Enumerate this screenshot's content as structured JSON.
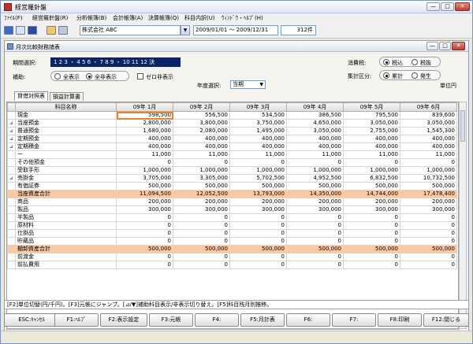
{
  "window": {
    "title": "経営羅針盤",
    "min": "—",
    "max": "□",
    "close": "✕"
  },
  "menu": [
    "ﾌｧｲﾙ(F)",
    "経営羅針盤(R)",
    "分析帳簿(B)",
    "会計帳簿(A)",
    "決算帳簿(Q)",
    "科目内訳(U)",
    "ｳｨﾝﾄﾞｳ・ﾍﾙﾌﾟ(H)"
  ],
  "toolbar": {
    "company": "株式会社 ABC",
    "period_range": "2009/01/01 〜 2009/12/31",
    "count": "312件"
  },
  "child": {
    "title": "月次比較財務諸表"
  },
  "controls": {
    "period_label": "期間選択:",
    "period_value": "1 2 3 ・ 4 5 6 ・ 7 8 9 ・ 10 11 12 決",
    "hojo_label": "補助:",
    "hojo_all": "全表示",
    "hojo_all_zan": "全非表示",
    "zero_label": "ゼロ非表示",
    "tax_label": "消費税:",
    "tax_incl": "税込",
    "tax_excl": "税抜",
    "agg_label": "集計区分:",
    "agg_cum": "累計",
    "agg_gen": "発生",
    "year_label": "年度選択:",
    "year_value": "当期",
    "unit": "単位円"
  },
  "tabs": [
    "貸借対照表",
    "損益計算書"
  ],
  "table": {
    "columns": [
      "科目名称",
      "09年 1月",
      "09年 2月",
      "09年 3月",
      "09年 4月",
      "09年 5月",
      "09年 6月"
    ],
    "rows": [
      {
        "exp": "",
        "name": "現金",
        "v": [
          "598,500",
          "556,500",
          "534,500",
          "386,500",
          "795,500",
          "839,600"
        ],
        "hl": false
      },
      {
        "exp": "⊿",
        "name": "当座預金",
        "v": [
          "2,800,000",
          "3,800,000",
          "3,750,000",
          "4,650,000",
          "3,050,000",
          "3,050,000"
        ],
        "hl": false
      },
      {
        "exp": "⊿",
        "name": "普通預金",
        "v": [
          "1,680,000",
          "2,080,000",
          "1,495,000",
          "3,050,000",
          "2,755,000",
          "1,545,300"
        ],
        "hl": false
      },
      {
        "exp": "⊿",
        "name": "定期預金",
        "v": [
          "400,000",
          "400,000",
          "400,000",
          "400,000",
          "400,000",
          "400,000"
        ],
        "hl": false
      },
      {
        "exp": "⊿",
        "name": "定期積金",
        "v": [
          "400,000",
          "400,000",
          "400,000",
          "400,000",
          "400,000",
          "400,000"
        ],
        "hl": false
      },
      {
        "exp": "",
        "name": "ー",
        "v": [
          "11,000",
          "11,000",
          "11,000",
          "11,000",
          "11,000",
          "11,000"
        ],
        "hl": false
      },
      {
        "exp": "",
        "name": "その他預金",
        "v": [
          "0",
          "0",
          "0",
          "0",
          "0",
          "0"
        ],
        "hl": false
      },
      {
        "exp": "",
        "name": "受取手形",
        "v": [
          "1,000,000",
          "1,000,000",
          "1,000,000",
          "1,000,000",
          "1,000,000",
          "1,000,000"
        ],
        "hl": false
      },
      {
        "exp": "⊿",
        "name": "売掛金",
        "v": [
          "3,705,000",
          "3,305,000",
          "5,702,500",
          "4,952,500",
          "6,832,500",
          "10,732,500"
        ],
        "hl": false
      },
      {
        "exp": "",
        "name": "有価証券",
        "v": [
          "500,000",
          "500,000",
          "500,000",
          "500,000",
          "500,000",
          "500,000"
        ],
        "hl": false
      },
      {
        "exp": "",
        "name": "当座資産合計",
        "v": [
          "11,094,500",
          "12,052,500",
          "13,793,000",
          "14,350,000",
          "14,744,000",
          "17,478,400"
        ],
        "hl": true
      },
      {
        "exp": "",
        "name": "商品",
        "v": [
          "200,000",
          "200,000",
          "200,000",
          "200,000",
          "200,000",
          "200,000"
        ],
        "hl": false
      },
      {
        "exp": "",
        "name": "製品",
        "v": [
          "300,000",
          "300,000",
          "300,000",
          "300,000",
          "300,000",
          "300,000"
        ],
        "hl": false
      },
      {
        "exp": "",
        "name": "半製品",
        "v": [
          "0",
          "0",
          "0",
          "0",
          "0",
          "0"
        ],
        "hl": false
      },
      {
        "exp": "",
        "name": "原材料",
        "v": [
          "0",
          "0",
          "0",
          "0",
          "0",
          "0"
        ],
        "hl": false
      },
      {
        "exp": "",
        "name": "仕掛品",
        "v": [
          "0",
          "0",
          "0",
          "0",
          "0",
          "0"
        ],
        "hl": false
      },
      {
        "exp": "",
        "name": "貯蔵品",
        "v": [
          "0",
          "0",
          "0",
          "0",
          "0",
          "0"
        ],
        "hl": false
      },
      {
        "exp": "",
        "name": "棚卸資産合計",
        "v": [
          "500,000",
          "500,000",
          "500,000",
          "500,000",
          "500,000",
          "500,000"
        ],
        "hl": true
      },
      {
        "exp": "",
        "name": "前渡金",
        "v": [
          "0",
          "0",
          "0",
          "0",
          "0",
          "0"
        ],
        "hl": false
      },
      {
        "exp": "",
        "name": "前払費用",
        "v": [
          "0",
          "0",
          "0",
          "0",
          "0",
          "0"
        ],
        "hl": false
      }
    ]
  },
  "hint": "[F2]単位切替(円/千円)。[F3]元帳にジャンプ。[⊿/▼]補助科目表示/非表示切り替え。[F5]科目残月別推移。",
  "fkeys": [
    "ESC:ｷｬﾝｾﾙ",
    "F1:ﾍﾙﾌﾟ",
    "F2:表示設定",
    "F3:元帳",
    "F4:",
    "F5:月計表",
    "F6:",
    "F7:",
    "F8:印刷",
    "F12:閉じる"
  ]
}
